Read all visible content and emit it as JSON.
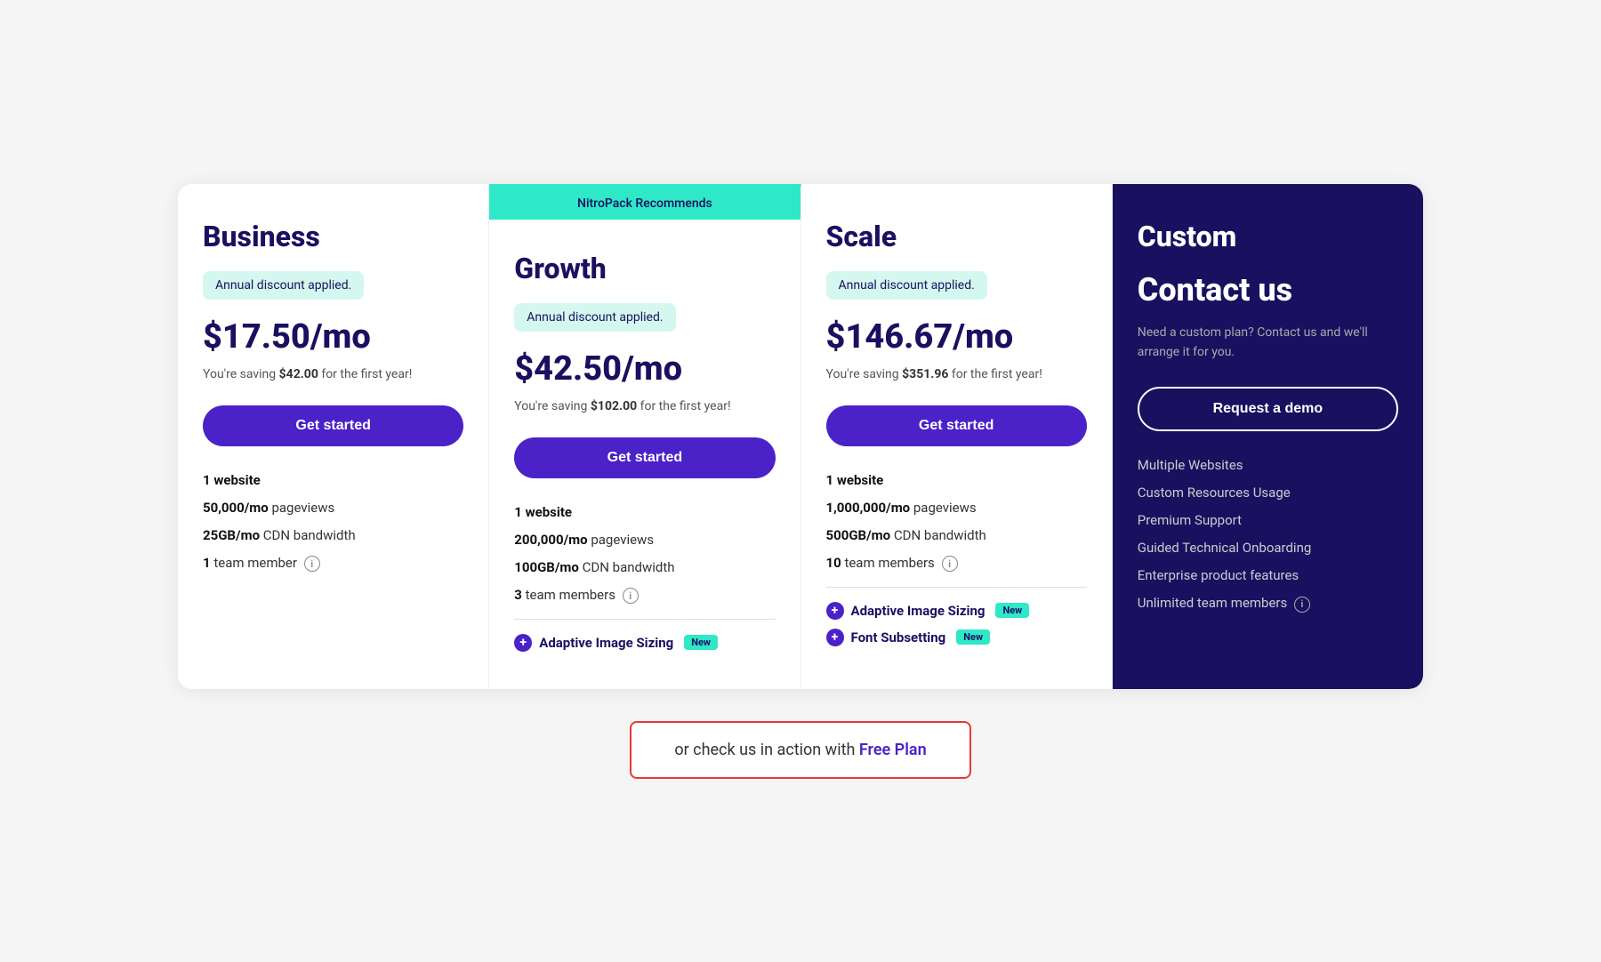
{
  "recommended_badge": "NitroPack Recommends",
  "plans": [
    {
      "id": "business",
      "name": "Business",
      "discount_text": "Annual discount applied.",
      "price": "$17.50/mo",
      "savings_prefix": "You're saving ",
      "savings_amount": "$42.00",
      "savings_suffix": " for the first year!",
      "cta_label": "Get started",
      "features": [
        {
          "type": "text",
          "bold": "1 website",
          "rest": ""
        },
        {
          "type": "text",
          "bold": "50,000/mo",
          "rest": " pageviews"
        },
        {
          "type": "text",
          "bold": "25GB/mo",
          "rest": " CDN bandwidth"
        },
        {
          "type": "text",
          "bold": "1",
          "rest": " team member",
          "info": true
        }
      ],
      "extras": []
    },
    {
      "id": "growth",
      "name": "Growth",
      "recommended": true,
      "discount_text": "Annual discount applied.",
      "price": "$42.50/mo",
      "savings_prefix": "You're saving ",
      "savings_amount": "$102.00",
      "savings_suffix": " for the first year!",
      "cta_label": "Get started",
      "features": [
        {
          "type": "text",
          "bold": "1 website",
          "rest": ""
        },
        {
          "type": "text",
          "bold": "200,000/mo",
          "rest": " pageviews"
        },
        {
          "type": "text",
          "bold": "100GB/mo",
          "rest": " CDN bandwidth"
        },
        {
          "type": "text",
          "bold": "3",
          "rest": " team members",
          "info": true
        }
      ],
      "extras": [
        {
          "label": "Adaptive Image Sizing",
          "badge": "New"
        }
      ]
    },
    {
      "id": "scale",
      "name": "Scale",
      "discount_text": "Annual discount applied.",
      "price": "$146.67/mo",
      "savings_prefix": "You're saving ",
      "savings_amount": "$351.96",
      "savings_suffix": " for the first year!",
      "cta_label": "Get started",
      "features": [
        {
          "type": "text",
          "bold": "1 website",
          "rest": ""
        },
        {
          "type": "text",
          "bold": "1,000,000/mo",
          "rest": " pageviews"
        },
        {
          "type": "text",
          "bold": "500GB/mo",
          "rest": " CDN bandwidth"
        },
        {
          "type": "text",
          "bold": "10",
          "rest": " team members",
          "info": true
        }
      ],
      "extras": [
        {
          "label": "Adaptive Image Sizing",
          "badge": "New"
        },
        {
          "label": "Font Subsetting",
          "badge": "New"
        }
      ]
    }
  ],
  "custom": {
    "name": "Custom",
    "contact_title": "Contact us",
    "description": "Need a custom plan? Contact us and we'll arrange it for you.",
    "cta_label": "Request a demo",
    "features": [
      "Multiple Websites",
      "Custom Resources Usage",
      "Premium Support",
      "Guided Technical Onboarding",
      "Enterprise product features",
      "Unlimited team members"
    ]
  },
  "free_plan": {
    "prefix": "or check us in action with ",
    "link_text": "Free Plan"
  },
  "colors": {
    "accent_teal": "#2ee8c8",
    "accent_purple": "#4a22c8",
    "dark_navy": "#1a1060",
    "new_badge_bg": "#2ee8c8",
    "free_plan_border": "#e53935"
  }
}
